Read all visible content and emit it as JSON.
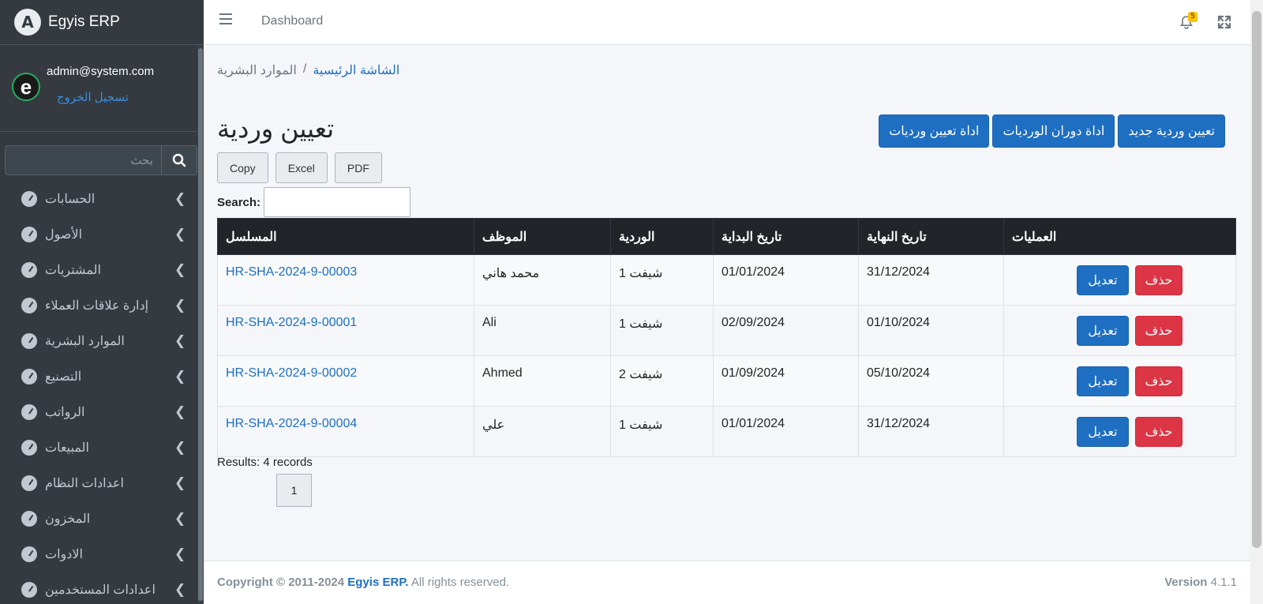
{
  "brand": {
    "logo_letter": "A",
    "name": "Egyis ERP"
  },
  "user": {
    "avatar_letter": "e",
    "email": "admin@system.com",
    "logout": "تسجيل الخروج"
  },
  "sidebar": {
    "search_placeholder": "بحث",
    "items": [
      {
        "label": "الحسابات"
      },
      {
        "label": "الأصول"
      },
      {
        "label": "المشتريات"
      },
      {
        "label": "إدارة علاقات العملاء"
      },
      {
        "label": "الموارد البشرية"
      },
      {
        "label": "التصنيع"
      },
      {
        "label": "الرواتب"
      },
      {
        "label": "المبيعات"
      },
      {
        "label": "اعدادات النظام"
      },
      {
        "label": "المخزون"
      },
      {
        "label": "الادوات"
      },
      {
        "label": "اعدادات المستخدمين"
      }
    ]
  },
  "topbar": {
    "dashboard": "Dashboard",
    "notification_count": "5"
  },
  "breadcrumb": {
    "home": "الشاشة الرئيسية",
    "separator": "/",
    "current": "الموارد البشرية"
  },
  "page": {
    "title": "تعيين وردية",
    "actions": {
      "new": "تعيين وردية جديد",
      "rotation": "اداة دوران الورديات",
      "assign": "اداة تعيين ورديات"
    },
    "export": {
      "copy": "Copy",
      "excel": "Excel",
      "pdf": "PDF"
    },
    "search_label": "Search:",
    "table": {
      "headers": {
        "serial": "المسلسل",
        "employee": "الموظف",
        "shift": "الوردية",
        "start": "تاريخ البداية",
        "end": "تاريخ النهاية",
        "ops": "العمليات"
      },
      "delete_label": "حذف",
      "edit_label": "تعديل",
      "rows": [
        {
          "serial": "HR-SHA-2024-9-00003",
          "employee": "محمد هاني",
          "shift": "شيفت 1",
          "start": "01/01/2024",
          "end": "31/12/2024"
        },
        {
          "serial": "HR-SHA-2024-9-00001",
          "employee": "Ali",
          "shift": "شيفت 1",
          "start": "02/09/2024",
          "end": "01/10/2024"
        },
        {
          "serial": "HR-SHA-2024-9-00002",
          "employee": "Ahmed",
          "shift": "شيفت 2",
          "start": "01/09/2024",
          "end": "05/10/2024"
        },
        {
          "serial": "HR-SHA-2024-9-00004",
          "employee": "علي",
          "shift": "شيفت 1",
          "start": "01/01/2024",
          "end": "31/12/2024"
        }
      ]
    },
    "results": "Results: 4 records",
    "page_number": "1"
  },
  "footer": {
    "copyright": "Copyright © 2011-2024",
    "brand": "Egyis ERP.",
    "rights": "All rights reserved.",
    "version_label": "Version",
    "version": "4.1.1"
  },
  "colors": {
    "primary": "#1e6fc2",
    "danger": "#dc3545",
    "sidebar": "#343a40",
    "header_dark": "#212529",
    "badge": "#ffc107"
  }
}
